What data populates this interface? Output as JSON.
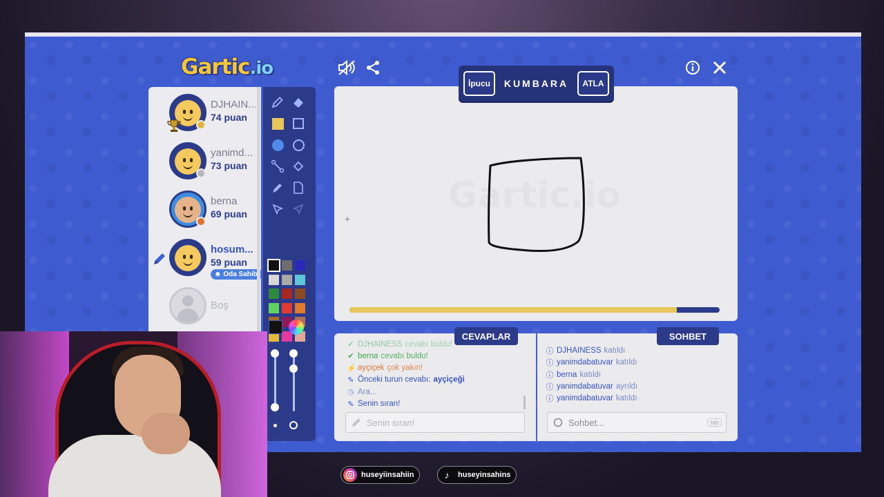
{
  "game": {
    "logo_main": "Gartic",
    "logo_suffix": ".io",
    "word_banner": {
      "hint_label": "İpucu",
      "word": "KUMBARA",
      "skip_label": "ATLA"
    }
  },
  "players": [
    {
      "name": "DJHAIN...",
      "score": "74 puan",
      "status_color": "#e0b43c",
      "trophy": true
    },
    {
      "name": "yanimd...",
      "score": "73 puan",
      "status_color": "#b6b6be",
      "trophy": false
    },
    {
      "name": "berna",
      "score": "69 puan",
      "status_color": "#e0742f",
      "trophy": false
    },
    {
      "name": "hosum...",
      "score": "59 puan",
      "badge": "Oda Sahibi",
      "drawing": true
    }
  ],
  "empty_slot": {
    "label": "Boş"
  },
  "palette": [
    "#111111",
    "#6e6e6e",
    "#2a2ab8",
    "#d8d8d8",
    "#a9a9a9",
    "#5ec6d6",
    "#2c8a3a",
    "#a8281f",
    "#8b4a1f",
    "#5fd35f",
    "#e33a2f",
    "#e07a2f",
    "#a76b28",
    "#8e1a5a",
    "#ab6f5c",
    "#e2b93a",
    "#e23aa0",
    "#e2a59a"
  ],
  "canvas": {
    "progress_fraction": 0.885,
    "watermark": "Gartic.io"
  },
  "answers": {
    "title": "CEVAPLAR",
    "messages": [
      {
        "icon": "check",
        "user": "DJHAINESS",
        "text": "cevabı buldu!",
        "color": "#3aa84a"
      },
      {
        "icon": "check",
        "user": "berna",
        "text": "cevabı buldu!",
        "color": "#3aa84a"
      },
      {
        "icon": "bolt",
        "user": "ayçiçek",
        "text": "çok yakın!",
        "color": "#e0742f"
      },
      {
        "icon": "pencil",
        "prefix": "Önceki turun cevabı:",
        "answer": "ayçiçeği",
        "color": "#3553c6"
      },
      {
        "icon": "clock",
        "text": "Ara...",
        "color": "#7b8bc4"
      },
      {
        "icon": "pencil",
        "text": "Senin sıran!",
        "color": "#3553c6"
      }
    ],
    "input_placeholder": "Senin sıran!"
  },
  "chat": {
    "title": "SOHBET",
    "messages": [
      {
        "user": "DJHAINESS",
        "text": "katıldı"
      },
      {
        "user": "yanimdabatuvar",
        "text": "katıldı"
      },
      {
        "user": "berna",
        "text": "katıldı"
      },
      {
        "user": "yanimdabatuvar",
        "text": "ayrıldı"
      },
      {
        "user": "yanimdabatuvar",
        "text": "katıldı"
      }
    ],
    "input_placeholder": "Sohbet...",
    "key_hint": "tab"
  },
  "socials": [
    {
      "platform": "instagram",
      "handle": "huseyiinsahiin"
    },
    {
      "platform": "tiktok",
      "handle": "huseyinsahins"
    }
  ]
}
